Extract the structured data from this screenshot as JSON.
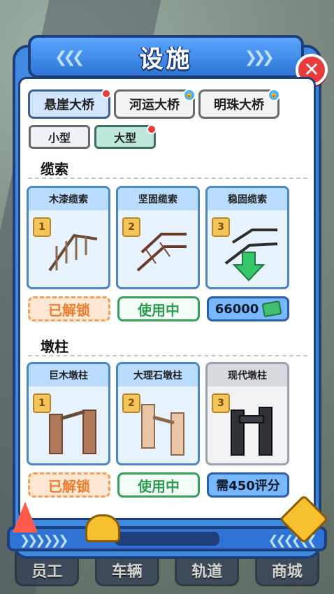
{
  "window": {
    "title": "设施"
  },
  "tabs": [
    {
      "label": "悬崖大桥",
      "active": true,
      "badge": "dot"
    },
    {
      "label": "河运大桥",
      "active": false,
      "badge": "lock"
    },
    {
      "label": "明珠大桥",
      "active": false,
      "badge": "lock"
    }
  ],
  "size_filters": [
    {
      "label": "小型",
      "active": false
    },
    {
      "label": "大型",
      "active": true
    }
  ],
  "sections": [
    {
      "title": "缆索",
      "items": [
        {
          "name": "木漆缆索",
          "rank": "1",
          "status": "已解锁"
        },
        {
          "name": "坚固缆索",
          "rank": "2",
          "status": "使用中"
        },
        {
          "name": "稳固缆索",
          "rank": "3",
          "price": "66000"
        }
      ]
    },
    {
      "title": "墩柱",
      "items": [
        {
          "name": "巨木墩柱",
          "rank": "1",
          "status": "已解锁"
        },
        {
          "name": "大理石墩柱",
          "rank": "2",
          "status": "使用中"
        },
        {
          "name": "现代墩柱",
          "rank": "3",
          "requirement": "需450评分"
        }
      ]
    }
  ],
  "bottom_nav": [
    "员工",
    "车辆",
    "轨道",
    "商城"
  ],
  "colors": {
    "accent": "#3f8ae0",
    "active_tab": "#d2e7ff",
    "in_use": "#2f9a54",
    "unlocked": "#f07b2b"
  }
}
